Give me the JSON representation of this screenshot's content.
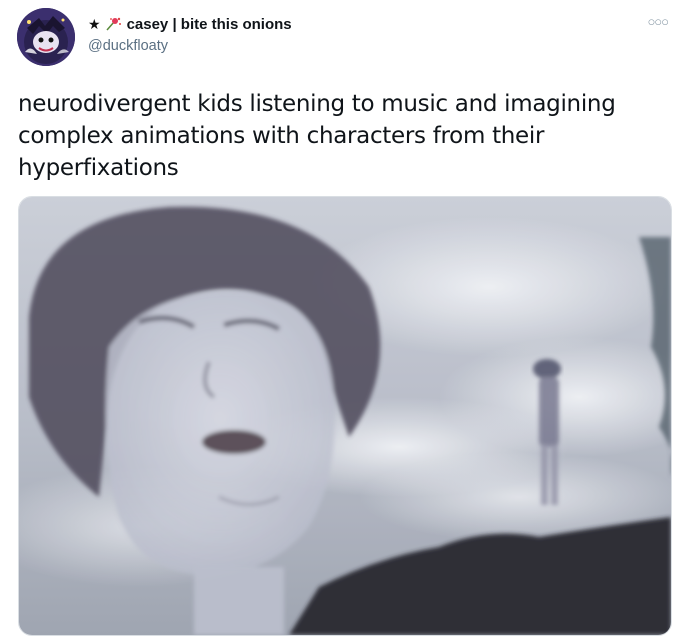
{
  "tweet": {
    "display_name": "casey | bite this onions",
    "name_prefix_star": "★",
    "handle": "@duckfloaty",
    "more_icon": "more-options-icon",
    "text": "neurodivergent kids listening to music and imagining complex animations with characters from their hyperfixations",
    "media": {
      "description_icon": "meme-image"
    }
  },
  "colors": {
    "text": "#0f1419",
    "secondary": "#5b7083",
    "border": "#d9dee3"
  }
}
